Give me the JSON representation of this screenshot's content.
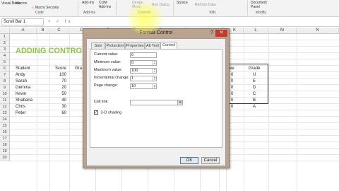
{
  "ribbon": {
    "visual_basic": "Visual Basic",
    "macros": "Macros",
    "macro_security": "Macro Security",
    "addins": "Add-Ins",
    "com_addins": "COM Add-Ins",
    "design_mode": "Design Mode",
    "run_dialog": "Run Dialog",
    "source": "Source",
    "refresh_data": "Refresh Data",
    "document_panel": "Document Panel",
    "groups": {
      "code": "Code",
      "addins": "Add-ins",
      "controls": "Controls",
      "xml": "XML",
      "modify": "Modify"
    }
  },
  "formula_bar": {
    "name_box": "Scroll Bar 1",
    "fx": "× ✓ fx"
  },
  "sheet": {
    "columns": [
      "A",
      "B",
      "C",
      "D",
      "E",
      "F",
      "G",
      "H",
      "I",
      "J",
      "K",
      "L",
      "M",
      "N"
    ],
    "rows": [
      "1",
      "2",
      "3",
      "4",
      "5",
      "6",
      "7",
      "8",
      "9",
      "10",
      "11",
      "12",
      "13",
      "14",
      "15",
      "16",
      "17",
      "18",
      "19",
      "20"
    ],
    "title": "ADDING CONTRO",
    "headers": {
      "student": "Student",
      "score": "Score",
      "grade_partial": "Gra",
      "score2_partial": "ee",
      "grade2": "Grade"
    },
    "students": [
      {
        "name": "Andy",
        "score": "100",
        "score2": "0",
        "grade": "U"
      },
      {
        "name": "Sarah",
        "score": "70",
        "score2": "0",
        "grade": "E"
      },
      {
        "name": "Gemma",
        "score": "20",
        "score2": "0",
        "grade": "D"
      },
      {
        "name": "Kevin",
        "score": "50",
        "score2": "0",
        "grade": "C"
      },
      {
        "name": "Shabana",
        "score": "40",
        "score2": "0",
        "grade": "B"
      },
      {
        "name": "Chris",
        "score": "30",
        "score2": "0",
        "grade": "A"
      },
      {
        "name": "Peter",
        "score": "60",
        "score2": "",
        "grade": ""
      }
    ]
  },
  "dialog": {
    "title": "Format Control",
    "help": "?",
    "close": "✕",
    "tabs": [
      "Size",
      "Protection",
      "Properties",
      "Alt Text",
      "Control"
    ],
    "active_tab": "Control",
    "fields": {
      "current_value_label": "Current value:",
      "current_value": "0",
      "minimum_value_label": "Minimum value:",
      "minimum_value": "0",
      "maximum_value_label": "Maximum value:",
      "maximum_value": "100",
      "incremental_change_label": "Incremental change:",
      "incremental_change": "1",
      "page_change_label": "Page change:",
      "page_change": "10",
      "cell_link_label": "Cell link:",
      "shading_label": "3-D shading"
    },
    "ok": "OK",
    "cancel": "Cancel"
  }
}
